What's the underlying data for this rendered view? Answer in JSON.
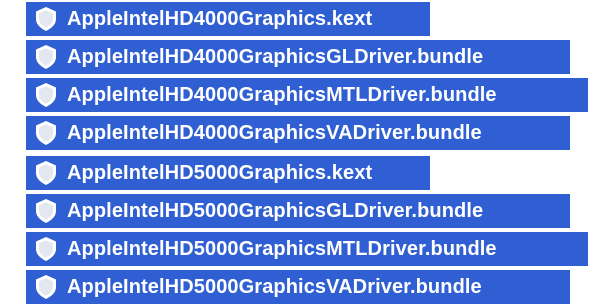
{
  "file_list": {
    "items": [
      {
        "name": "AppleIntelHD4000Graphics.kext",
        "icon": "kext-bundle-icon"
      },
      {
        "name": "AppleIntelHD4000GraphicsGLDriver.bundle",
        "icon": "kext-bundle-icon"
      },
      {
        "name": "AppleIntelHD4000GraphicsMTLDriver.bundle",
        "icon": "kext-bundle-icon"
      },
      {
        "name": "AppleIntelHD4000GraphicsVADriver.bundle",
        "icon": "kext-bundle-icon"
      },
      {
        "name": "AppleIntelHD5000Graphics.kext",
        "icon": "kext-bundle-icon"
      },
      {
        "name": "AppleIntelHD5000GraphicsGLDriver.bundle",
        "icon": "kext-bundle-icon"
      },
      {
        "name": "AppleIntelHD5000GraphicsMTLDriver.bundle",
        "icon": "kext-bundle-icon"
      },
      {
        "name": "AppleIntelHD5000GraphicsVADriver.bundle",
        "icon": "kext-bundle-icon"
      }
    ]
  },
  "colors": {
    "selection": "#2f5fd2",
    "text": "#ffffff"
  }
}
